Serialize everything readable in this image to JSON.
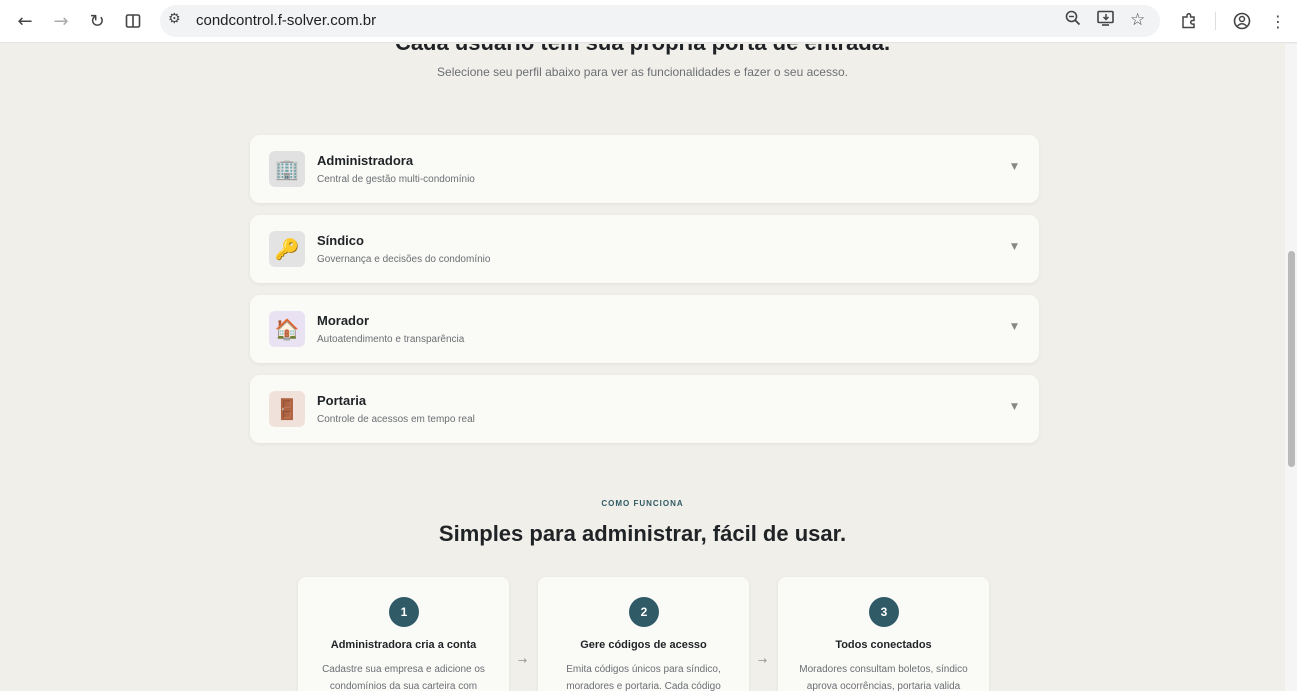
{
  "browser": {
    "url": "condcontrol.f-solver.com.br",
    "icons": [
      "back-icon",
      "forward-icon",
      "reload-icon",
      "split-view-icon",
      "site-settings-icon",
      "zoom-icon",
      "install-app-icon",
      "bookmark-star-icon",
      "extensions-icon",
      "profile-icon",
      "menu-icon"
    ]
  },
  "hero": {
    "heading": "Cada usuário tem sua própria porta de entrada.",
    "subtitle": "Selecione seu perfil abaixo para ver as funcionalidades e fazer o seu acesso."
  },
  "profiles": [
    {
      "name": "Administradora",
      "description": "Central de gestão multi-condomínio",
      "icon": "building-icon",
      "glyph": "🏢",
      "color": "#e1e1e1"
    },
    {
      "name": "Síndico",
      "description": "Governança e decisões do condomínio",
      "icon": "key-icon",
      "glyph": "🔑",
      "color": "#e3e3e3"
    },
    {
      "name": "Morador",
      "description": "Autoatendimento e transparência",
      "icon": "house-icon",
      "glyph": "🏠",
      "color": "#e8e2f3"
    },
    {
      "name": "Portaria",
      "description": "Controle de acessos em tempo real",
      "icon": "door-icon",
      "glyph": "🚪",
      "color": "#f0e1da"
    }
  ],
  "how_it_works": {
    "eyebrow": "COMO FUNCIONA",
    "title": "Simples para administrar, fácil de usar.",
    "steps": [
      {
        "number": "1",
        "title": "Administradora cria a conta",
        "text": "Cadastre sua empresa e adicione os condomínios da sua carteira com"
      },
      {
        "number": "2",
        "title": "Gere códigos de acesso",
        "text": "Emita códigos únicos para síndico, moradores e portaria. Cada código"
      },
      {
        "number": "3",
        "title": "Todos conectados",
        "text": "Moradores consultam boletos, síndico aprova ocorrências, portaria valida"
      }
    ],
    "arrow": "→"
  }
}
